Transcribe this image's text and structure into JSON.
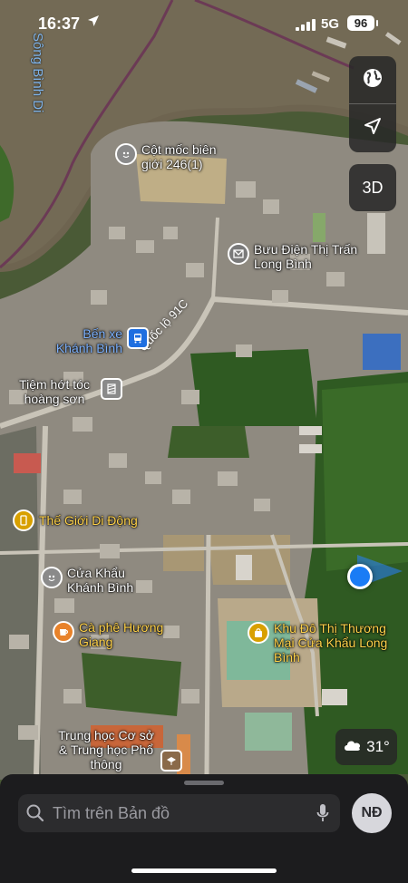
{
  "status_bar": {
    "time": "16:37",
    "location_arrow": "location-arrow-icon",
    "network": "5G",
    "battery": "96"
  },
  "map": {
    "type": "satellite",
    "river_label": "Sông Bình Di",
    "road_label": "Quốc lộ 91C",
    "pois": [
      {
        "name": "Cột mốc biên giới 246(1)",
        "icon": "landmark-icon",
        "color": "#8a8a8a",
        "label_color": "#ffffff"
      },
      {
        "name": "Bưu Điện Thị Trấn Long Bình",
        "icon": "mail-icon",
        "color": "#7a7a7a",
        "label_color": "#ffffff"
      },
      {
        "name": "Bến xe Khánh Bình",
        "icon": "bus-icon",
        "color": "#1f6fe0",
        "label_color": "#7fb4ff"
      },
      {
        "name": "Tiệm hớt tóc hoàng sơn",
        "icon": "barber-icon",
        "color": "#8a8a8a",
        "label_color": "#ffffff"
      },
      {
        "name": "Thế Giới Di Động",
        "icon": "phone-icon",
        "color": "#d8a000",
        "label_color": "#ffd24a"
      },
      {
        "name": "Cửa Khẩu Khánh Bình",
        "icon": "landmark-icon",
        "color": "#8a8a8a",
        "label_color": "#ffffff"
      },
      {
        "name": "Cà phê Hương Giang",
        "icon": "coffee-icon",
        "color": "#e8822a",
        "label_color": "#ffd24a"
      },
      {
        "name": "Khu Đô Thị Thương Mại Cửa Khẩu Long Bình",
        "icon": "shopping-bag-icon",
        "color": "#d8a000",
        "label_color": "#ffd24a"
      },
      {
        "name": "Trung học Cơ sở & Trung học Phổ thông",
        "icon": "school-icon",
        "color": "#8a6a4a",
        "label_color": "#ffffff"
      }
    ]
  },
  "controls": {
    "map_mode_icon": "globe-icon",
    "locate_icon": "location-arrow-icon",
    "view_3d": "3D"
  },
  "weather": {
    "icon": "cloud-icon",
    "temperature": "31°"
  },
  "search": {
    "placeholder": "Tìm trên Bản đồ",
    "mic_icon": "microphone-icon"
  },
  "account": {
    "initials": "NĐ"
  }
}
